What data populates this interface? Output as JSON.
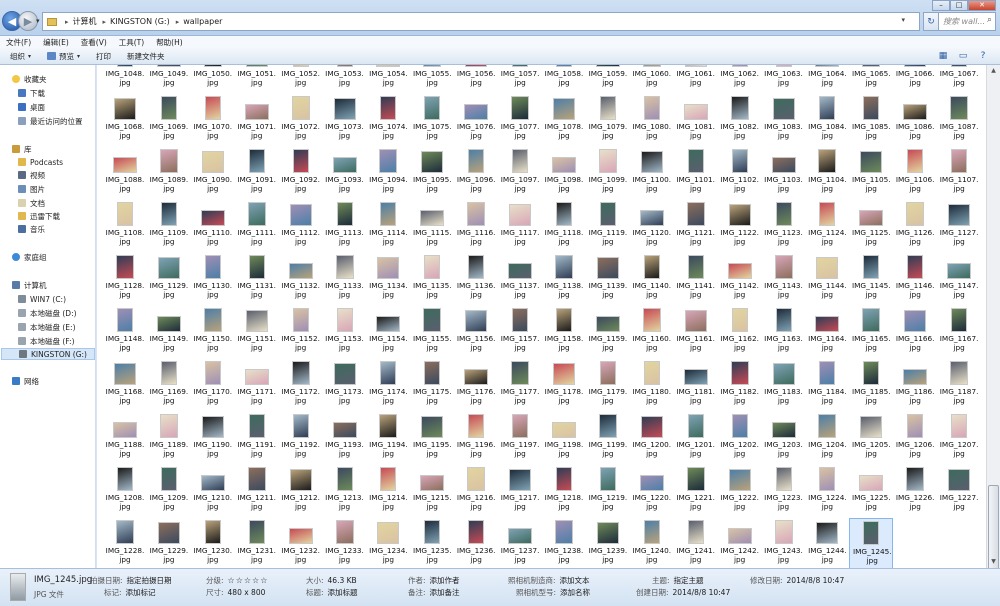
{
  "address": {
    "crumbs": [
      "计算机",
      "KINGSTON (G:)",
      "wallpaper"
    ],
    "search_placeholder": "搜索 wall..."
  },
  "menu": [
    "文件(F)",
    "编辑(E)",
    "查看(V)",
    "工具(T)",
    "帮助(H)"
  ],
  "toolbar": {
    "organize": "组织",
    "preview": "预览",
    "print": "打印",
    "new_folder": "新建文件夹"
  },
  "nav": {
    "favorites": "收藏夹",
    "favorite_items": [
      "下载",
      "桌面",
      "最近访问的位置"
    ],
    "libraries": "库",
    "library_items": [
      "Podcasts",
      "视频",
      "图片",
      "文档",
      "迅雷下载",
      "音乐"
    ],
    "homegroup": "家庭组",
    "computer": "计算机",
    "drives": [
      "WIN7 (C:)",
      "本地磁盘 (D:)",
      "本地磁盘 (E:)",
      "本地磁盘 (F:)",
      "KINGSTON (G:)"
    ],
    "network": "网络"
  },
  "files": {
    "ext": "jpg",
    "selected": "IMG_1245.",
    "rows": [
      [
        "IMG_1048.",
        "IMG_1049.",
        "IMG_1050.",
        "IMG_1051.",
        "IMG_1052.",
        "IMG_1053.",
        "IMG_1054.",
        "IMG_1055.",
        "IMG_1056.",
        "IMG_1057.",
        "IMG_1058.",
        "IMG_1059.",
        "IMG_1060.",
        "IMG_1061.",
        "IMG_1062.",
        "IMG_1063.",
        "IMG_1064.",
        "IMG_1065.",
        "IMG_1066.",
        "IMG_1067."
      ],
      [
        "IMG_1068.",
        "IMG_1069.",
        "IMG_1070.",
        "IMG_1071.",
        "IMG_1072.",
        "IMG_1073.",
        "IMG_1074.",
        "IMG_1075.",
        "IMG_1076.",
        "IMG_1077.",
        "IMG_1078.",
        "IMG_1079.",
        "IMG_1080.",
        "IMG_1081.",
        "IMG_1082.",
        "IMG_1083.",
        "IMG_1084.",
        "IMG_1085.",
        "IMG_1086.",
        "IMG_1087."
      ],
      [
        "IMG_1088.",
        "IMG_1089.",
        "IMG_1090.",
        "IMG_1091.",
        "IMG_1092.",
        "IMG_1093.",
        "IMG_1094.",
        "IMG_1095.",
        "IMG_1096.",
        "IMG_1097.",
        "IMG_1098.",
        "IMG_1099.",
        "IMG_1100.",
        "IMG_1101.",
        "IMG_1102.",
        "IMG_1103.",
        "IMG_1104.",
        "IMG_1105.",
        "IMG_1106.",
        "IMG_1107."
      ],
      [
        "IMG_1108.",
        "IMG_1109.",
        "IMG_1110.",
        "IMG_1111.",
        "IMG_1112.",
        "IMG_1113.",
        "IMG_1114.",
        "IMG_1115.",
        "IMG_1116.",
        "IMG_1117.",
        "IMG_1118.",
        "IMG_1119.",
        "IMG_1120.",
        "IMG_1121.",
        "IMG_1122.",
        "IMG_1123.",
        "IMG_1124.",
        "IMG_1125.",
        "IMG_1126.",
        "IMG_1127."
      ],
      [
        "IMG_1128.",
        "IMG_1129.",
        "IMG_1130.",
        "IMG_1131.",
        "IMG_1132.",
        "IMG_1133.",
        "IMG_1134.",
        "IMG_1135.",
        "IMG_1136.",
        "IMG_1137.",
        "IMG_1138.",
        "IMG_1139.",
        "IMG_1140.",
        "IMG_1141.",
        "IMG_1142.",
        "IMG_1143.",
        "IMG_1144.",
        "IMG_1145.",
        "IMG_1146.",
        "IMG_1147."
      ],
      [
        "IMG_1148.",
        "IMG_1149.",
        "IMG_1150.",
        "IMG_1151.",
        "IMG_1152.",
        "IMG_1153.",
        "IMG_1154.",
        "IMG_1155.",
        "IMG_1156.",
        "IMG_1157.",
        "IMG_1158.",
        "IMG_1159.",
        "IMG_1160.",
        "IMG_1161.",
        "IMG_1162.",
        "IMG_1163.",
        "IMG_1164.",
        "IMG_1165.",
        "IMG_1166.",
        "IMG_1167."
      ],
      [
        "IMG_1168.",
        "IMG_1169.",
        "IMG_1170.",
        "IMG_1171.",
        "IMG_1172.",
        "IMG_1173.",
        "IMG_1174.",
        "IMG_1175.",
        "IMG_1176.",
        "IMG_1177.",
        "IMG_1178.",
        "IMG_1179.",
        "IMG_1180.",
        "IMG_1181.",
        "IMG_1182.",
        "IMG_1183.",
        "IMG_1184.",
        "IMG_1185.",
        "IMG_1186.",
        "IMG_1187."
      ],
      [
        "IMG_1188.",
        "IMG_1189.",
        "IMG_1190.",
        "IMG_1191.",
        "IMG_1192.",
        "IMG_1193.",
        "IMG_1194.",
        "IMG_1195.",
        "IMG_1196.",
        "IMG_1197.",
        "IMG_1198.",
        "IMG_1199.",
        "IMG_1200.",
        "IMG_1201.",
        "IMG_1202.",
        "IMG_1203.",
        "IMG_1204.",
        "IMG_1205.",
        "IMG_1206.",
        "IMG_1207."
      ],
      [
        "IMG_1208.",
        "IMG_1209.",
        "IMG_1210.",
        "IMG_1211.",
        "IMG_1212.",
        "IMG_1213.",
        "IMG_1214.",
        "IMG_1215.",
        "IMG_1216.",
        "IMG_1217.",
        "IMG_1218.",
        "IMG_1219.",
        "IMG_1220.",
        "IMG_1221.",
        "IMG_1222.",
        "IMG_1223.",
        "IMG_1224.",
        "IMG_1225.",
        "IMG_1226.",
        "IMG_1227."
      ],
      [
        "IMG_1228.",
        "IMG_1229.",
        "IMG_1230.",
        "IMG_1231.",
        "IMG_1232.",
        "IMG_1233.",
        "IMG_1234.",
        "IMG_1235.",
        "IMG_1236.",
        "IMG_1237.",
        "IMG_1238.",
        "IMG_1239.",
        "IMG_1240.",
        "IMG_1241.",
        "IMG_1242.",
        "IMG_1243.",
        "IMG_1244.",
        "IMG_1245."
      ]
    ]
  },
  "details": {
    "name": "IMG_1245.jpg",
    "type": "JPG 文件",
    "date_taken_k": "拍摄日期:",
    "date_taken_v": "指定拍摄日期",
    "tags_k": "标记:",
    "tags_v": "添加标记",
    "rating_k": "分级:",
    "rating_stars": "☆☆☆☆☆",
    "dims_k": "尺寸:",
    "dims_v": "480 x 800",
    "size_k": "大小:",
    "size_v": "46.3 KB",
    "title_k": "标题:",
    "title_v": "添加标题",
    "author_k": "作者:",
    "author_v": "添加作者",
    "comment_k": "备注:",
    "comment_v": "添加备注",
    "maker_k": "照相机制造商:",
    "maker_v": "添加文本",
    "model_k": "照相机型号:",
    "model_v": "添加名称",
    "subject_k": "主题:",
    "subject_v": "指定主题",
    "created_k": "创建日期:",
    "created_v": "2014/8/8 10:47",
    "modified_k": "修改日期:",
    "modified_v": "2014/8/8 10:47"
  }
}
